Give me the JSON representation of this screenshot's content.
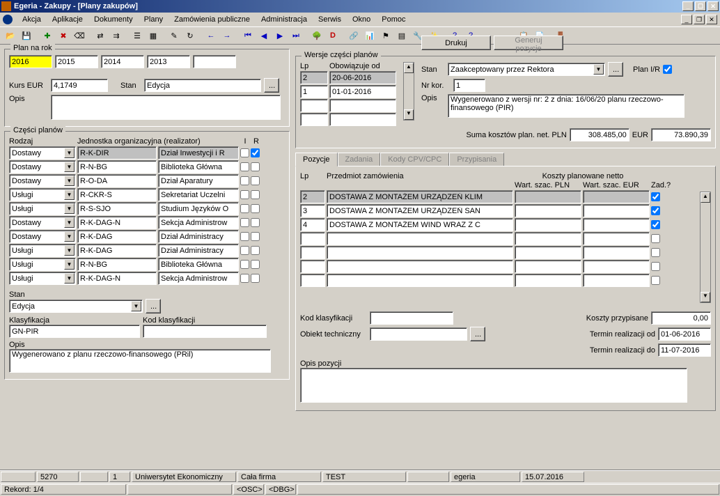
{
  "title": "Egeria - Zakupy - [Plany zakupów]",
  "menu": [
    "Akcja",
    "Aplikacje",
    "Dokumenty",
    "Plany",
    "Zamówienia publiczne",
    "Administracja",
    "Serwis",
    "Okno",
    "Pomoc"
  ],
  "buttons": {
    "drukuj": "Drukuj",
    "generuj": "Generuj pozycje"
  },
  "plan_rok": {
    "legend": "Plan na rok",
    "years": [
      "2016",
      "2015",
      "2014",
      "2013",
      ""
    ],
    "kurs_lbl": "Kurs EUR",
    "kurs": "4,1749",
    "stan_lbl": "Stan",
    "stan": "Edycja",
    "opis_lbl": "Opis",
    "opis": ""
  },
  "wersje": {
    "legend": "Wersje części planów",
    "lp_lbl": "Lp",
    "obow_lbl": "Obowiązuje od",
    "rows": [
      {
        "lp": "2",
        "od": "20-06-2016"
      },
      {
        "lp": "1",
        "od": "01-01-2016"
      },
      {
        "lp": "",
        "od": ""
      },
      {
        "lp": "",
        "od": ""
      }
    ],
    "stan_lbl": "Stan",
    "stan": "Zaakceptowany przez Rektora",
    "planir_lbl": "Plan I/R",
    "nrkor_lbl": "Nr kor.",
    "nrkor": "1",
    "opis_lbl": "Opis",
    "opis": "Wygenerowano z wersji nr: 2 z dnia: 16/06/20 planu rzeczowo-finansowego (PIR)",
    "suma_lbl": "Suma kosztów plan. net. PLN",
    "suma_pln": "308.485,00",
    "eur_lbl": "EUR",
    "suma_eur": "73.890,39"
  },
  "czesci": {
    "legend": "Części planów",
    "rodzaj_lbl": "Rodzaj",
    "jedn_lbl": "Jednostka organizacyjna (realizator)",
    "i_lbl": "I",
    "r_lbl": "R",
    "rows": [
      {
        "rodzaj": "Dostawy",
        "kod": "R-K-DIR",
        "nazwa": "Dział Inwestycji i R",
        "i": false,
        "r": true,
        "sel": true
      },
      {
        "rodzaj": "Dostawy",
        "kod": "R-N-BG",
        "nazwa": "Biblioteka Główna",
        "i": false,
        "r": false
      },
      {
        "rodzaj": "Dostawy",
        "kod": "R-O-DA",
        "nazwa": "Dział Aparatury",
        "i": false,
        "r": false
      },
      {
        "rodzaj": "Usługi",
        "kod": "R-CKR-S",
        "nazwa": "Sekretariat Uczelni",
        "i": false,
        "r": false
      },
      {
        "rodzaj": "Usługi",
        "kod": "R-S-SJO",
        "nazwa": "Studium Języków O",
        "i": false,
        "r": false
      },
      {
        "rodzaj": "Dostawy",
        "kod": "R-K-DAG-N",
        "nazwa": "Sekcja Administrow",
        "i": false,
        "r": false
      },
      {
        "rodzaj": "Dostawy",
        "kod": "R-K-DAG",
        "nazwa": "Dział Administracy",
        "i": false,
        "r": false
      },
      {
        "rodzaj": "Usługi",
        "kod": "R-K-DAG",
        "nazwa": "Dział Administracy",
        "i": false,
        "r": false
      },
      {
        "rodzaj": "Usługi",
        "kod": "R-N-BG",
        "nazwa": "Biblioteka Główna",
        "i": false,
        "r": false
      },
      {
        "rodzaj": "Usługi",
        "kod": "R-K-DAG-N",
        "nazwa": "Sekcja Administrow",
        "i": false,
        "r": false
      }
    ],
    "stan_lbl": "Stan",
    "stan": "Edycja",
    "klas_lbl": "Klasyfikacja",
    "klas": "GN-PIR",
    "kodklas_lbl": "Kod klasyfikacji",
    "kodklas": "",
    "opis_lbl": "Opis",
    "opis": "Wygenerowano z planu rzeczowo-finansowego (PRil)"
  },
  "tabs": [
    "Pozycje",
    "Zadania",
    "Kody CPV/CPC",
    "Przypisania"
  ],
  "pozycje": {
    "lp_lbl": "Lp",
    "przedmiot_lbl": "Przedmiot zamówienia",
    "koszt_hdr": "Koszty planowane netto",
    "pln_lbl": "Wart. szac. PLN",
    "eur_lbl": "Wart. szac. EUR",
    "zad_lbl": "Zad.?",
    "rows": [
      {
        "lp": "2",
        "p": "DOSTAWA Z MONTAŻEM URZĄDZEŃ KLIM",
        "pln": "",
        "eur": "",
        "z": true,
        "sel": true
      },
      {
        "lp": "3",
        "p": "DOSTAWA Z MONTAŻEM URZĄDZEŃ SAN",
        "pln": "",
        "eur": "",
        "z": true
      },
      {
        "lp": "4",
        "p": "DOSTAWA Z MONTAŻEM WIND WRAZ Z C",
        "pln": "",
        "eur": "",
        "z": true
      },
      {
        "lp": "",
        "p": "",
        "pln": "",
        "eur": "",
        "z": false
      },
      {
        "lp": "",
        "p": "",
        "pln": "",
        "eur": "",
        "z": false
      },
      {
        "lp": "",
        "p": "",
        "pln": "",
        "eur": "",
        "z": false
      },
      {
        "lp": "",
        "p": "",
        "pln": "",
        "eur": "",
        "z": false
      }
    ],
    "kodklas_lbl": "Kod klasyfikacji",
    "kodklas": "",
    "obiekt_lbl": "Obiekt techniczny",
    "obiekt": "",
    "przyp_lbl": "Koszty przypisane",
    "przyp": "0,00",
    "termod_lbl": "Termin realizacji od",
    "termod": "01-06-2016",
    "termdo_lbl": "Termin realizacji do",
    "termdo": "11-07-2016",
    "opispoz_lbl": "Opis pozycji",
    "opispoz": ""
  },
  "status": {
    "row1": [
      "",
      "5270",
      "",
      "1",
      "Uniwersytet Ekonomiczny",
      "Cała firma",
      "TEST",
      "",
      "egeria",
      "15.07.2016"
    ],
    "rekord": "Rekord: 1/4",
    "osc": "<OSC>",
    "dbg": "<DBG>"
  }
}
